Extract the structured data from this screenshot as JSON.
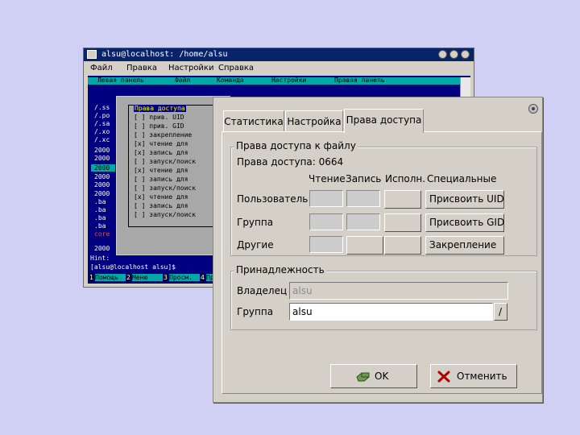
{
  "terminal": {
    "title": "alsu@localhost: /home/alsu",
    "menu": [
      "Файл",
      "Правка",
      "Настройки",
      "Справка"
    ],
    "mc_menu": [
      "Левая панель",
      "Файл",
      "Команда",
      "Настройки",
      "Правая панель"
    ],
    "file_lines": [
      "/.ss",
      "/.ро",
      "/.sa",
      "/.хо",
      "/.хс",
      "2000",
      "2000",
      "2000",
      "2000",
      "2000",
      "2000",
      ".ba",
      ".ba",
      ".ba",
      ".ba",
      "core",
      "2000"
    ],
    "perm_dialog": {
      "title": "Права доступа",
      "items": [
        "[ ] прив. UID",
        "[ ] прив. GID",
        "[ ] закрепление",
        "[x] чтение для",
        "[x] запись для",
        "[ ] запуск/поиск",
        "[x] чтение для",
        "[ ] запись для",
        "[ ] запуск/поиск",
        "[x] чтение для",
        "[ ] запись для",
        "[ ] запуск/поиск"
      ]
    },
    "hint": "Hint:",
    "prompt": "[alsu@localhost alsu]$",
    "fkeys": [
      {
        "num": "1",
        "label": "Помощь"
      },
      {
        "num": "2",
        "label": "Меню"
      },
      {
        "num": "3",
        "label": "Просм."
      },
      {
        "num": "4",
        "label": "Пра"
      }
    ]
  },
  "dialog": {
    "tabs": [
      "Статистика",
      "Настройка",
      "Права доступа"
    ],
    "active_tab": 2,
    "permissions_group": {
      "title": "Права доступа к файлу",
      "mode_label": "Права доступа: 0664",
      "columns": [
        "Чтение",
        "Запись",
        "Исполн.",
        "Специальные"
      ],
      "rows": [
        {
          "label": "Пользователь",
          "special_button": "Присвоить UID"
        },
        {
          "label": "Группа",
          "special_button": "Присвоить GID"
        },
        {
          "label": "Другие",
          "special_button": "Закрепление"
        }
      ]
    },
    "ownership_group": {
      "title": "Принадлежность",
      "owner_label": "Владелец",
      "owner_value": "alsu",
      "group_label": "Группа",
      "group_value": "alsu",
      "group_button": "/"
    },
    "ok_label": "OK",
    "cancel_label": "Отменить",
    "colors": {
      "cancel_x": "#b30000",
      "ok_icon": "#4a7a3a"
    }
  }
}
